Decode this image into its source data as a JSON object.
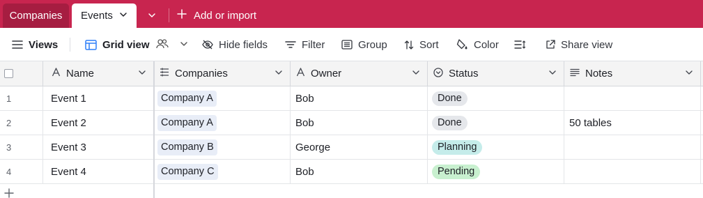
{
  "tabs": {
    "companies_label": "Companies",
    "events_label": "Events",
    "add_import_label": "Add or import"
  },
  "toolbar": {
    "views_label": "Views",
    "grid_view_label": "Grid view",
    "hide_fields_label": "Hide fields",
    "filter_label": "Filter",
    "group_label": "Group",
    "sort_label": "Sort",
    "color_label": "Color",
    "share_view_label": "Share view"
  },
  "columns": {
    "name": "Name",
    "companies": "Companies",
    "owner": "Owner",
    "status": "Status",
    "notes": "Notes"
  },
  "rows": [
    {
      "num": "1",
      "name": "Event 1",
      "company": "Company A",
      "owner": "Bob",
      "status": "Done",
      "notes": ""
    },
    {
      "num": "2",
      "name": "Event 2",
      "company": "Company A",
      "owner": "Bob",
      "status": "Done",
      "notes": "50 tables"
    },
    {
      "num": "3",
      "name": "Event 3",
      "company": "Company B",
      "owner": "George",
      "status": "Planning",
      "notes": ""
    },
    {
      "num": "4",
      "name": "Event 4",
      "company": "Company C",
      "owner": "Bob",
      "status": "Pending",
      "notes": ""
    }
  ],
  "status_colors": {
    "Done": {
      "bg": "#e5e7eb",
      "fg": "#1d1f25"
    },
    "Planning": {
      "bg": "#c5ecea",
      "fg": "#1d1f25"
    },
    "Pending": {
      "bg": "#c8f0cf",
      "fg": "#1d1f25"
    }
  },
  "colors": {
    "brand": "#c8254f",
    "brand_dark": "#a61d41",
    "chip_bg": "#e8edf7"
  },
  "icons": {
    "tab_chevron": "chevron-down-icon",
    "add": "plus-icon",
    "views": "hamburger-icon",
    "grid": "grid-icon",
    "people": "people-icon",
    "hide": "eye-slash-icon",
    "filter": "filter-icon",
    "group": "group-icon",
    "sort": "sort-icon",
    "color": "paint-bucket-icon",
    "row_height": "row-height-icon",
    "share": "external-link-icon"
  }
}
